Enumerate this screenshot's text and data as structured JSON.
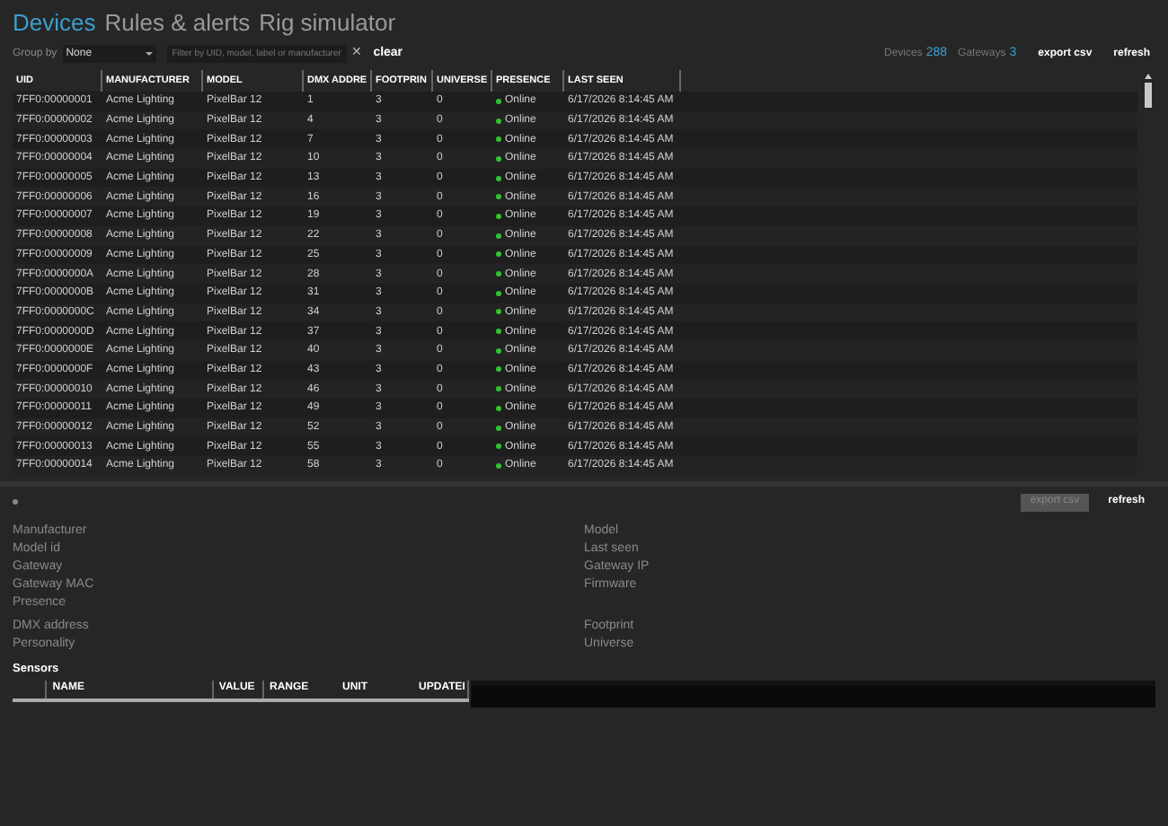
{
  "tabs": [
    {
      "label": "Devices",
      "selected": true
    },
    {
      "label": "Rules & alerts",
      "selected": false
    },
    {
      "label": "Rig simulator",
      "selected": false
    }
  ],
  "toolbar": {
    "group_by_label": "Group by",
    "group_by_value": "None",
    "filter_placeholder": "Filter by UID, model, label or manufacturer",
    "clear_symbol": "✕",
    "clear_label": "clear",
    "devices_label": "Devices",
    "devices_count": "288",
    "gateways_label": "Gateways",
    "gateways_count": "3",
    "export_label": "export csv",
    "refresh_label": "refresh"
  },
  "table": {
    "columns": [
      "UID",
      "MANUFACTURER",
      "MODEL",
      "DMX ADDRE",
      "FOOTPRIN",
      "UNIVERSE",
      "PRESENCE",
      "LAST SEEN"
    ],
    "rows": [
      {
        "uid": "7FF0:00000001",
        "manufacturer": "Acme Lighting",
        "model": "PixelBar 12",
        "dmx": "1",
        "footprint": "3",
        "universe": "0",
        "presence": "Online",
        "color": "#2fc42f",
        "last_seen": "6/17/2026 8:14:45 AM"
      },
      {
        "uid": "7FF0:00000002",
        "manufacturer": "Acme Lighting",
        "model": "PixelBar 12",
        "dmx": "4",
        "footprint": "3",
        "universe": "0",
        "presence": "Online",
        "color": "#2fc42f",
        "last_seen": "6/17/2026 8:14:45 AM"
      },
      {
        "uid": "7FF0:00000003",
        "manufacturer": "Acme Lighting",
        "model": "PixelBar 12",
        "dmx": "7",
        "footprint": "3",
        "universe": "0",
        "presence": "Online",
        "color": "#2fc42f",
        "last_seen": "6/17/2026 8:14:45 AM"
      },
      {
        "uid": "7FF0:00000004",
        "manufacturer": "Acme Lighting",
        "model": "PixelBar 12",
        "dmx": "10",
        "footprint": "3",
        "universe": "0",
        "presence": "Online",
        "color": "#2fc42f",
        "last_seen": "6/17/2026 8:14:45 AM"
      },
      {
        "uid": "7FF0:00000005",
        "manufacturer": "Acme Lighting",
        "model": "PixelBar 12",
        "dmx": "13",
        "footprint": "3",
        "universe": "0",
        "presence": "Online",
        "color": "#2fc42f",
        "last_seen": "6/17/2026 8:14:45 AM"
      },
      {
        "uid": "7FF0:00000006",
        "manufacturer": "Acme Lighting",
        "model": "PixelBar 12",
        "dmx": "16",
        "footprint": "3",
        "universe": "0",
        "presence": "Online",
        "color": "#2fc42f",
        "last_seen": "6/17/2026 8:14:45 AM"
      },
      {
        "uid": "7FF0:00000007",
        "manufacturer": "Acme Lighting",
        "model": "PixelBar 12",
        "dmx": "19",
        "footprint": "3",
        "universe": "0",
        "presence": "Online",
        "color": "#2fc42f",
        "last_seen": "6/17/2026 8:14:45 AM"
      },
      {
        "uid": "7FF0:00000008",
        "manufacturer": "Acme Lighting",
        "model": "PixelBar 12",
        "dmx": "22",
        "footprint": "3",
        "universe": "0",
        "presence": "Online",
        "color": "#2fc42f",
        "last_seen": "6/17/2026 8:14:45 AM"
      },
      {
        "uid": "7FF0:00000009",
        "manufacturer": "Acme Lighting",
        "model": "PixelBar 12",
        "dmx": "25",
        "footprint": "3",
        "universe": "0",
        "presence": "Online",
        "color": "#2fc42f",
        "last_seen": "6/17/2026 8:14:45 AM"
      },
      {
        "uid": "7FF0:0000000A",
        "manufacturer": "Acme Lighting",
        "model": "PixelBar 12",
        "dmx": "28",
        "footprint": "3",
        "universe": "0",
        "presence": "Online",
        "color": "#2fc42f",
        "last_seen": "6/17/2026 8:14:45 AM"
      },
      {
        "uid": "7FF0:0000000B",
        "manufacturer": "Acme Lighting",
        "model": "PixelBar 12",
        "dmx": "31",
        "footprint": "3",
        "universe": "0",
        "presence": "Online",
        "color": "#2fc42f",
        "last_seen": "6/17/2026 8:14:45 AM"
      },
      {
        "uid": "7FF0:0000000C",
        "manufacturer": "Acme Lighting",
        "model": "PixelBar 12",
        "dmx": "34",
        "footprint": "3",
        "universe": "0",
        "presence": "Online",
        "color": "#2fc42f",
        "last_seen": "6/17/2026 8:14:45 AM"
      },
      {
        "uid": "7FF0:0000000D",
        "manufacturer": "Acme Lighting",
        "model": "PixelBar 12",
        "dmx": "37",
        "footprint": "3",
        "universe": "0",
        "presence": "Online",
        "color": "#2fc42f",
        "last_seen": "6/17/2026 8:14:45 AM"
      },
      {
        "uid": "7FF0:0000000E",
        "manufacturer": "Acme Lighting",
        "model": "PixelBar 12",
        "dmx": "40",
        "footprint": "3",
        "universe": "0",
        "presence": "Online",
        "color": "#2fc42f",
        "last_seen": "6/17/2026 8:14:45 AM"
      },
      {
        "uid": "7FF0:0000000F",
        "manufacturer": "Acme Lighting",
        "model": "PixelBar 12",
        "dmx": "43",
        "footprint": "3",
        "universe": "0",
        "presence": "Online",
        "color": "#2fc42f",
        "last_seen": "6/17/2026 8:14:45 AM"
      },
      {
        "uid": "7FF0:00000010",
        "manufacturer": "Acme Lighting",
        "model": "PixelBar 12",
        "dmx": "46",
        "footprint": "3",
        "universe": "0",
        "presence": "Online",
        "color": "#2fc42f",
        "last_seen": "6/17/2026 8:14:45 AM"
      },
      {
        "uid": "7FF0:00000011",
        "manufacturer": "Acme Lighting",
        "model": "PixelBar 12",
        "dmx": "49",
        "footprint": "3",
        "universe": "0",
        "presence": "Online",
        "color": "#2fc42f",
        "last_seen": "6/17/2026 8:14:45 AM"
      },
      {
        "uid": "7FF0:00000012",
        "manufacturer": "Acme Lighting",
        "model": "PixelBar 12",
        "dmx": "52",
        "footprint": "3",
        "universe": "0",
        "presence": "Online",
        "color": "#2fc42f",
        "last_seen": "6/17/2026 8:14:45 AM"
      },
      {
        "uid": "7FF0:00000013",
        "manufacturer": "Acme Lighting",
        "model": "PixelBar 12",
        "dmx": "55",
        "footprint": "3",
        "universe": "0",
        "presence": "Online",
        "color": "#2fc42f",
        "last_seen": "6/17/2026 8:14:45 AM"
      },
      {
        "uid": "7FF0:00000014",
        "manufacturer": "Acme Lighting",
        "model": "PixelBar 12",
        "dmx": "58",
        "footprint": "3",
        "universe": "0",
        "presence": "Online",
        "color": "#2fc42f",
        "last_seen": "6/17/2026 8:14:45 AM"
      }
    ]
  },
  "details": {
    "export_label": "export csv",
    "export_disabled": true,
    "refresh_label": "refresh",
    "left": [
      [
        "Manufacturer",
        "Model id",
        "Gateway",
        "Gateway MAC",
        "Presence"
      ],
      [
        "DMX address",
        "Personality"
      ]
    ],
    "right": [
      [
        "Model",
        "Last seen",
        "Gateway IP",
        "Firmware"
      ],
      [
        "Footprint",
        "Universe"
      ]
    ]
  },
  "sensors": {
    "title": "Sensors",
    "columns": [
      "NAME",
      "VALUE",
      "RANGE",
      "UNIT",
      "UPDATEI"
    ]
  }
}
